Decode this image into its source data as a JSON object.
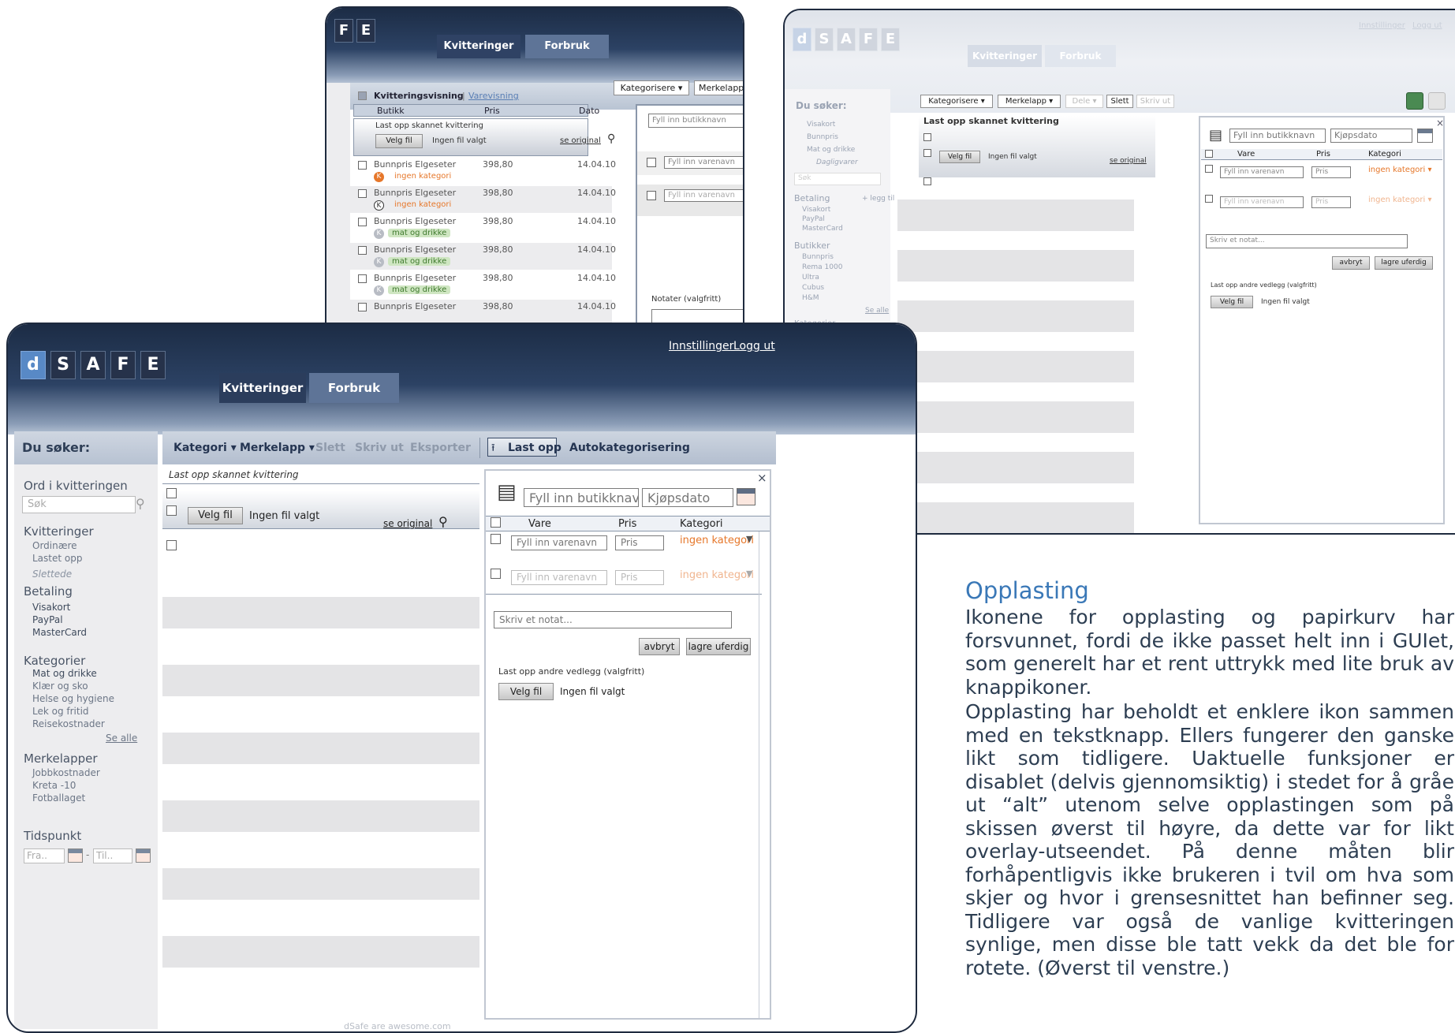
{
  "brand": {
    "letters": [
      "d",
      "S",
      "A",
      "F",
      "E"
    ]
  },
  "tabs": {
    "receipts": "Kvitteringer",
    "usage": "Forbruk"
  },
  "top_links": {
    "settings": "Innstillinger",
    "logout": "Logg ut"
  },
  "toolbar_main": {
    "category": "Kategori ▾",
    "tag": "Merkelapp ▾",
    "delete": "Slett",
    "print": "Skriv ut",
    "export": "Eksporter",
    "upload": "Last opp",
    "autocat": "Autokategorisering"
  },
  "sidebar": {
    "title": "Du søker:",
    "search_label": "Ord i kvitteringen",
    "search_placeholder": "Søk",
    "receipts_title": "Kvitteringer",
    "receipts_items": [
      "Ordinære",
      "Lastet opp"
    ],
    "receipts_deleted": "Slettede",
    "payment_title": "Betaling",
    "payment_items": [
      "Visakort",
      "PayPal",
      "MasterCard"
    ],
    "categories_title": "Kategorier",
    "categories_items": [
      "Mat og drikke",
      "Klær og sko",
      "Helse og hygiene",
      "Lek og fritid",
      "Reisekostnader"
    ],
    "see_all": "Se alle",
    "tags_title": "Merkelapper",
    "tags_items": [
      "Jobbkostnader",
      "Kreta -10",
      "Fotballaget"
    ],
    "time_title": "Tidspunkt",
    "from_placeholder": "Fra..",
    "to_placeholder": "Til..",
    "dash": "-"
  },
  "upload_area": {
    "title": "Last opp skannet kvittering",
    "choose_file": "Velg fil",
    "no_file": "Ingen fil valgt",
    "see_original": "se original"
  },
  "panel": {
    "store_placeholder": "Fyll inn butikknavn",
    "date_placeholder": "Kjøpsdato",
    "col_item": "Vare",
    "col_price": "Pris",
    "col_category": "Kategori",
    "item_placeholder": "Fyll inn varenavn",
    "price_placeholder": "Pris",
    "no_category": "ingen kategori",
    "note_placeholder": "Skriv et notat...",
    "cancel": "avbryt",
    "save_draft": "lagre uferdig",
    "attach_label": "Last opp andre vedlegg (valgfritt)",
    "choose_file": "Velg fil",
    "no_file": "Ingen fil valgt",
    "close": "×"
  },
  "footer": "dSafe are awesome.com",
  "top_left_shot": {
    "tiles": [
      "F",
      "E"
    ],
    "view_label": "Kvitteringsvisning",
    "view_sep": "|",
    "view_alt": "Varevisning",
    "categorize": "Kategorisere ▾",
    "tag": "Merkelapp",
    "col_store": "Butikk",
    "col_price": "Pris",
    "col_date": "Dato",
    "upload_title": "Last opp skannet kvittering",
    "choose_file": "Velg fil",
    "no_file": "Ingen fil valgt",
    "see_original": "se original",
    "store_placeholder": "Fyll inn butikknavn",
    "item_placeholder": "Fyll inn varenavn",
    "notes": "Notater (valgfritt)",
    "rows": [
      {
        "store": "Bunnpris Elgeseter",
        "price": "398,80",
        "date": "14.04.10",
        "tag": "ingen kategori"
      },
      {
        "store": "Bunnpris Elgeseter",
        "price": "398,80",
        "date": "14.04.10",
        "tag": "ingen kategori"
      },
      {
        "store": "Bunnpris Elgeseter",
        "price": "398,80",
        "date": "14.04.10",
        "tag": "mat og drikke"
      },
      {
        "store": "Bunnpris Elgeseter",
        "price": "398,80",
        "date": "14.04.10",
        "tag": "mat og drikke"
      },
      {
        "store": "Bunnpris Elgeseter",
        "price": "398,80",
        "date": "14.04.10",
        "tag": "mat og drikke"
      },
      {
        "store": "Bunnpris Elgeseter",
        "price": "398,80",
        "date": "14.04.10",
        "tag": ""
      }
    ]
  },
  "top_right_shot": {
    "toolbar": [
      "Kategorisere ▾",
      "Merkelapp ▾",
      "Dele ▾",
      "Slett",
      "Skriv ut"
    ],
    "sidebar_title": "Du søker:",
    "side_items": [
      "Visakort",
      "Bunnpris",
      "Mat og drikke",
      "Dagligvarer"
    ],
    "search": "Søk",
    "payment": "Betaling",
    "add_to": "+ legg til",
    "payment_items": [
      "Visakort",
      "PayPal",
      "MasterCard"
    ],
    "stores": "Butikker",
    "store_items": [
      "Bunnpris",
      "Rema 1000",
      "Ultra",
      "Cubus",
      "H&M"
    ],
    "see_all": "Se alle",
    "categories": "Kategorier",
    "upload_title": "Last opp skannet kvittering",
    "choose_file": "Velg fil",
    "no_file": "Ingen fil valgt",
    "see_original": "se original",
    "store_placeholder": "Fyll inn butikknavn",
    "date_placeholder": "Kjøpsdato",
    "col_item": "Vare",
    "col_price": "Pris",
    "col_category": "Kategori",
    "item_placeholder": "Fyll inn varenavn",
    "price_placeholder": "Pris",
    "no_category": "ingen kategori ▾",
    "note_placeholder": "Skriv et notat...",
    "cancel": "avbryt",
    "save_draft": "lagre uferdig",
    "attach_label": "Last opp andre vedlegg (valgfritt)"
  },
  "description": {
    "heading": "Opplasting",
    "paragraph1": "Ikonene for opplasting og papirkurv har forsvunnet, fordi de ikke passet helt inn i GUIet, som generelt har et rent uttrykk med lite bruk av knappikoner.",
    "paragraph2": "Opplasting har beholdt et enklere ikon sammen med en tekstknapp. Ellers fungerer den ganske likt som tidligere. Uaktuelle funksjoner er disablet (delvis gjennomsiktig) i stedet for å gråe ut “alt” utenom selve opplastingen som på skissen øverst til høyre, da dette var for likt overlay-utseendet. På denne måten blir forhåpentligvis ikke brukeren i tvil om hva som skjer og hvor i grensesnittet han befinner seg. Tidligere var også de vanlige kvitteringen synlige, men disse ble tatt vekk da det ble for rotete. (Øverst til venstre.)"
  },
  "colors": {
    "navy": "#1c2c45",
    "accent_blue": "#5889c6",
    "orange": "#e6772a",
    "heading_blue": "#3a78b7"
  }
}
